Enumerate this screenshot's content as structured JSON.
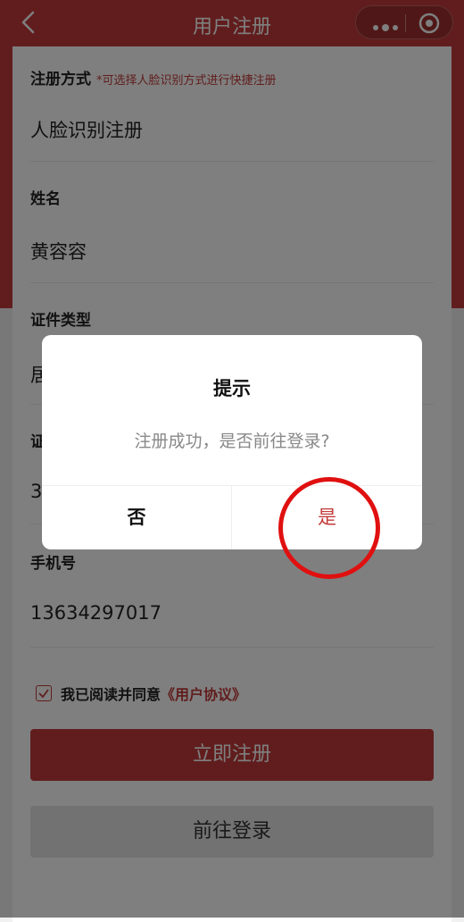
{
  "nav": {
    "title": "用户注册"
  },
  "form": {
    "reg_method_label": "注册方式",
    "reg_method_hint": "*可选择人脸识别方式进行快捷注册",
    "reg_method_value": "人脸识别注册",
    "name_label": "姓名",
    "name_value": "黄容容",
    "id_type_label": "证件类型",
    "id_type_value": "居",
    "id_number_label": "证",
    "id_number_value": "3",
    "phone_label": "手机号",
    "phone_value": "13634297017",
    "agree_text": "我已阅读并同意",
    "agree_link": "《用户协议》",
    "register_button": "立即注册",
    "login_button": "前往登录"
  },
  "dialog": {
    "title": "提示",
    "message": "注册成功，是否前往登录?",
    "no_label": "否",
    "yes_label": "是"
  },
  "colors": {
    "brand_red": "#c33a3a",
    "annotation_red": "#e01010"
  },
  "icons": [
    "back-icon",
    "more-icon",
    "target-icon",
    "check-icon"
  ]
}
